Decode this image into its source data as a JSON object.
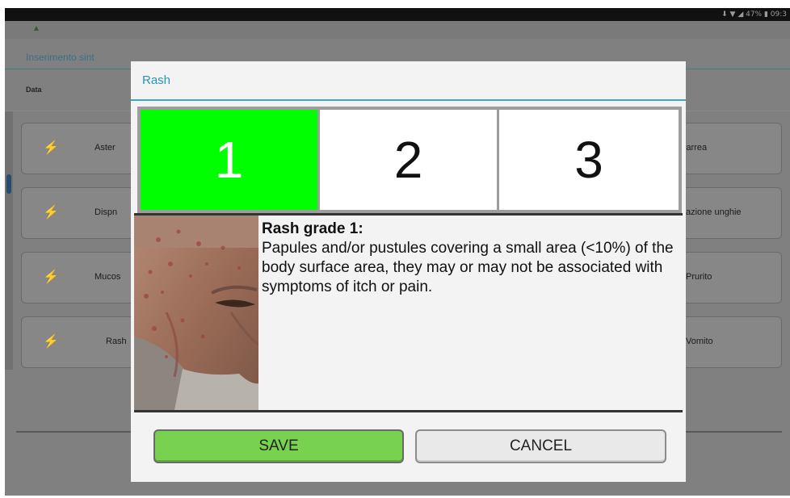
{
  "status_bar": {
    "text": "⬇ ▼ ◢ 47% ▮ 09:3"
  },
  "background": {
    "title": "Inserimento sint",
    "column_label": "Data",
    "left_rows": [
      {
        "label": "Aster"
      },
      {
        "label": "Dispn"
      },
      {
        "label": "Mucos"
      },
      {
        "label": "Rash"
      }
    ],
    "right_rows": [
      {
        "label": "Diarrea"
      },
      {
        "label": "azione unghie"
      },
      {
        "label": "Prurito"
      },
      {
        "label": "Vomito"
      }
    ]
  },
  "dialog": {
    "title": "Rash",
    "grades": [
      {
        "label": "1",
        "selected": true
      },
      {
        "label": "2",
        "selected": false
      },
      {
        "label": "3",
        "selected": false
      }
    ],
    "selected_color": "#00ff00",
    "description_title": "Rash grade 1:",
    "description_body": "Papules and/or pustules covering a small area (<10%) of the body surface area, they may or may not be associated with symptoms of itch or pain.",
    "save_label": "SAVE",
    "cancel_label": "CANCEL"
  }
}
